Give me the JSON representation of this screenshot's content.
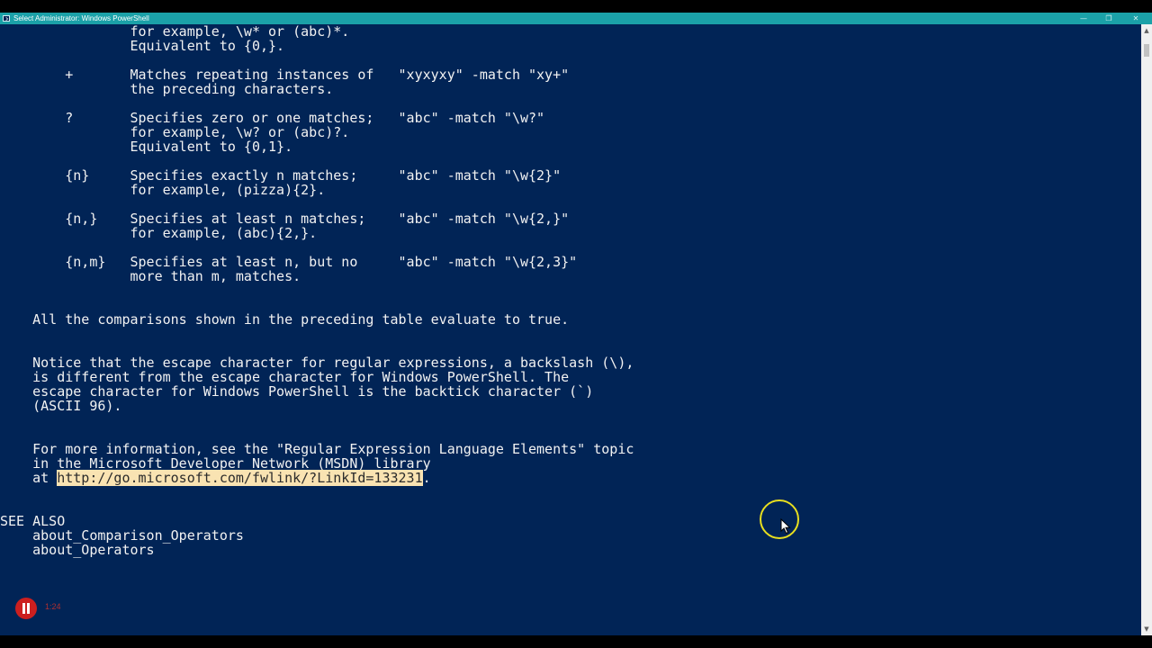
{
  "window": {
    "title": "Select Administrator: Windows PowerShell",
    "minimize_glyph": "—",
    "restore_glyph": "❐",
    "close_glyph": "✕"
  },
  "console": {
    "lines": [
      "                for example, \\w* or (abc)*.",
      "                Equivalent to {0,}.",
      "",
      "        +       Matches repeating instances of   \"xyxyxy\" -match \"xy+\"",
      "                the preceding characters.",
      "",
      "        ?       Specifies zero or one matches;   \"abc\" -match \"\\w?\"",
      "                for example, \\w? or (abc)?.",
      "                Equivalent to {0,1}.",
      "",
      "        {n}     Specifies exactly n matches;     \"abc\" -match \"\\w{2}\"",
      "                for example, (pizza){2}.",
      "",
      "        {n,}    Specifies at least n matches;    \"abc\" -match \"\\w{2,}\"",
      "                for example, (abc){2,}.",
      "",
      "        {n,m}   Specifies at least n, but no     \"abc\" -match \"\\w{2,3}\"",
      "                more than m, matches.",
      "",
      "",
      "    All the comparisons shown in the preceding table evaluate to true.",
      "",
      "",
      "    Notice that the escape character for regular expressions, a backslash (\\),",
      "    is different from the escape character for Windows PowerShell. The",
      "    escape character for Windows PowerShell is the backtick character (`)",
      "    (ASCII 96).",
      "",
      "",
      "    For more information, see the \"Regular Expression Language Elements\" topic",
      "    in the Microsoft Developer Network (MSDN) library",
      "",
      "",
      "",
      "SEE ALSO",
      "    about_Comparison_Operators",
      "    about_Operators"
    ],
    "link_line": {
      "prefix": "    at ",
      "selected": "http://go.microsoft.com/fwlink/?LinkId=133231",
      "suffix": "."
    }
  },
  "recording": {
    "time": "1:24"
  },
  "colors": {
    "console_background": "#012456",
    "console_text": "#f2f2f2",
    "titlebar": "#1ba1a8",
    "selection": "#f9e3b2",
    "cursor_ring": "#e8df1f",
    "record_button": "#cc1f1f"
  }
}
